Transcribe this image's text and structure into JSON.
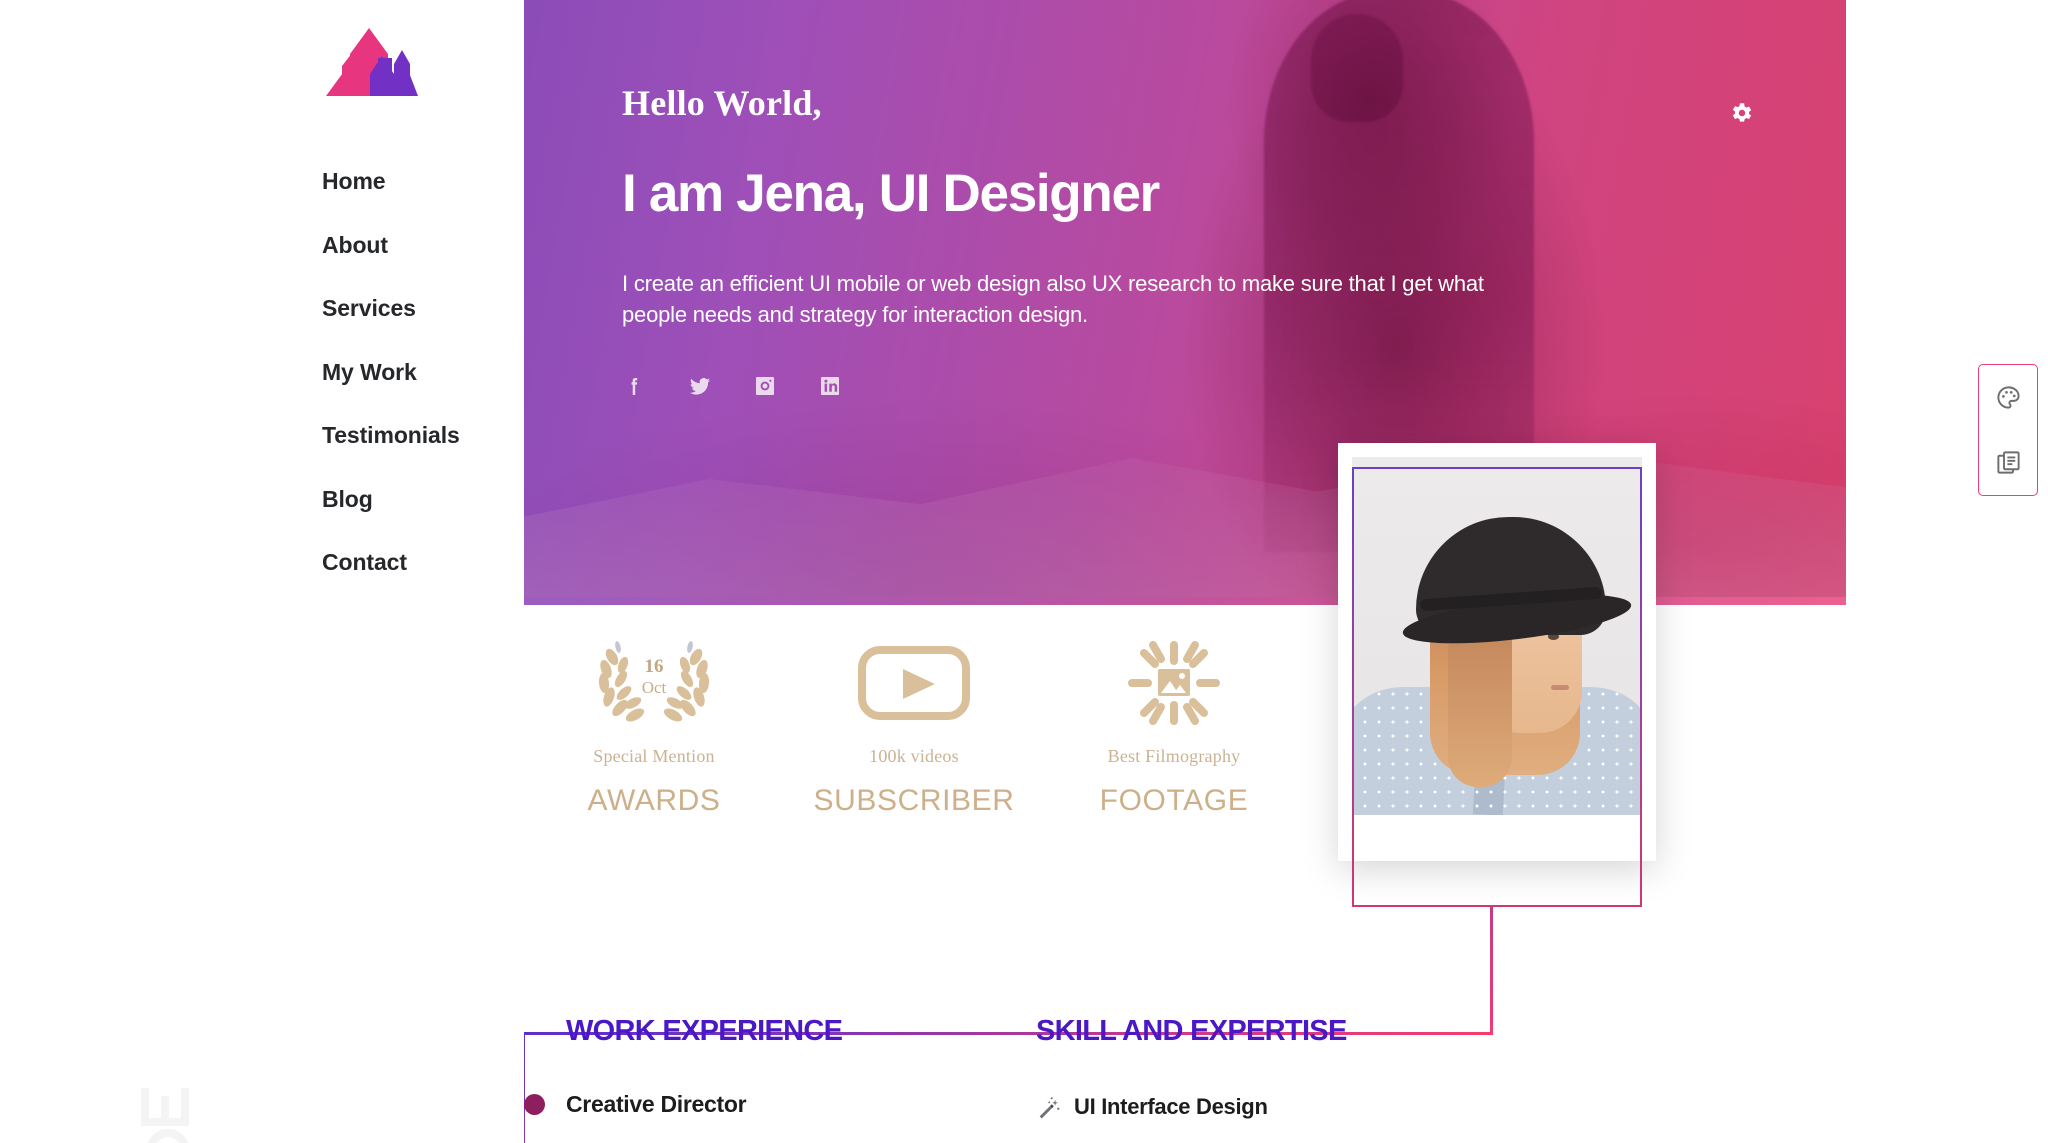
{
  "brand": {
    "logo_name": "lu-arrows-logo",
    "logo_colors": [
      "#e8357f",
      "#7230c4"
    ]
  },
  "sidebar": {
    "nav_items": [
      {
        "label": "Home"
      },
      {
        "label": "About"
      },
      {
        "label": "Services"
      },
      {
        "label": "My Work"
      },
      {
        "label": "Testimonials"
      },
      {
        "label": "Blog"
      },
      {
        "label": "Contact"
      }
    ],
    "watermark_name": "crown-watermark"
  },
  "hero": {
    "eyebrow": "Hello World,",
    "title": "I am Jena, UI Designer",
    "description": "I create an efficient UI mobile or web design also UX research to make sure that I get what people needs and strategy for interaction design.",
    "gradient_start": "#8b4cb8",
    "gradient_end": "#d8416f",
    "socials": [
      {
        "name": "facebook-icon"
      },
      {
        "name": "twitter-icon"
      },
      {
        "name": "instagram-icon"
      },
      {
        "name": "linkedin-icon"
      }
    ],
    "settings_icon": "gear-icon"
  },
  "awards": {
    "accent_color": "#cdb08a",
    "items": [
      {
        "icon": "laurel-wreath-icon",
        "badge_number": "16",
        "badge_month": "Oct",
        "subtitle": "Special Mention",
        "title": "AWARDS"
      },
      {
        "icon": "play-video-icon",
        "subtitle": "100k videos",
        "title": "SUBSCRIBER"
      },
      {
        "icon": "sunburst-image-icon",
        "subtitle": "Best Filmography",
        "title": "FOOTAGE"
      }
    ]
  },
  "profile": {
    "photo_name": "portrait-woman-with-hat",
    "frame_gradient": [
      "#6c3fc4",
      "#d6356f"
    ]
  },
  "bottom": {
    "work": {
      "heading": "WORK EXPERIENCE",
      "entries": [
        {
          "title": "Creative Director"
        }
      ]
    },
    "skills": {
      "heading": "SKILL AND EXPERTISE",
      "entries": [
        {
          "icon": "magic-wand-icon",
          "title": "UI Interface Design"
        }
      ]
    },
    "heading_color": "#4a18c6"
  },
  "tools_panel": {
    "border_color": "#ee3d77",
    "buttons": [
      {
        "name": "palette-icon"
      },
      {
        "name": "layout-pages-icon"
      }
    ]
  }
}
